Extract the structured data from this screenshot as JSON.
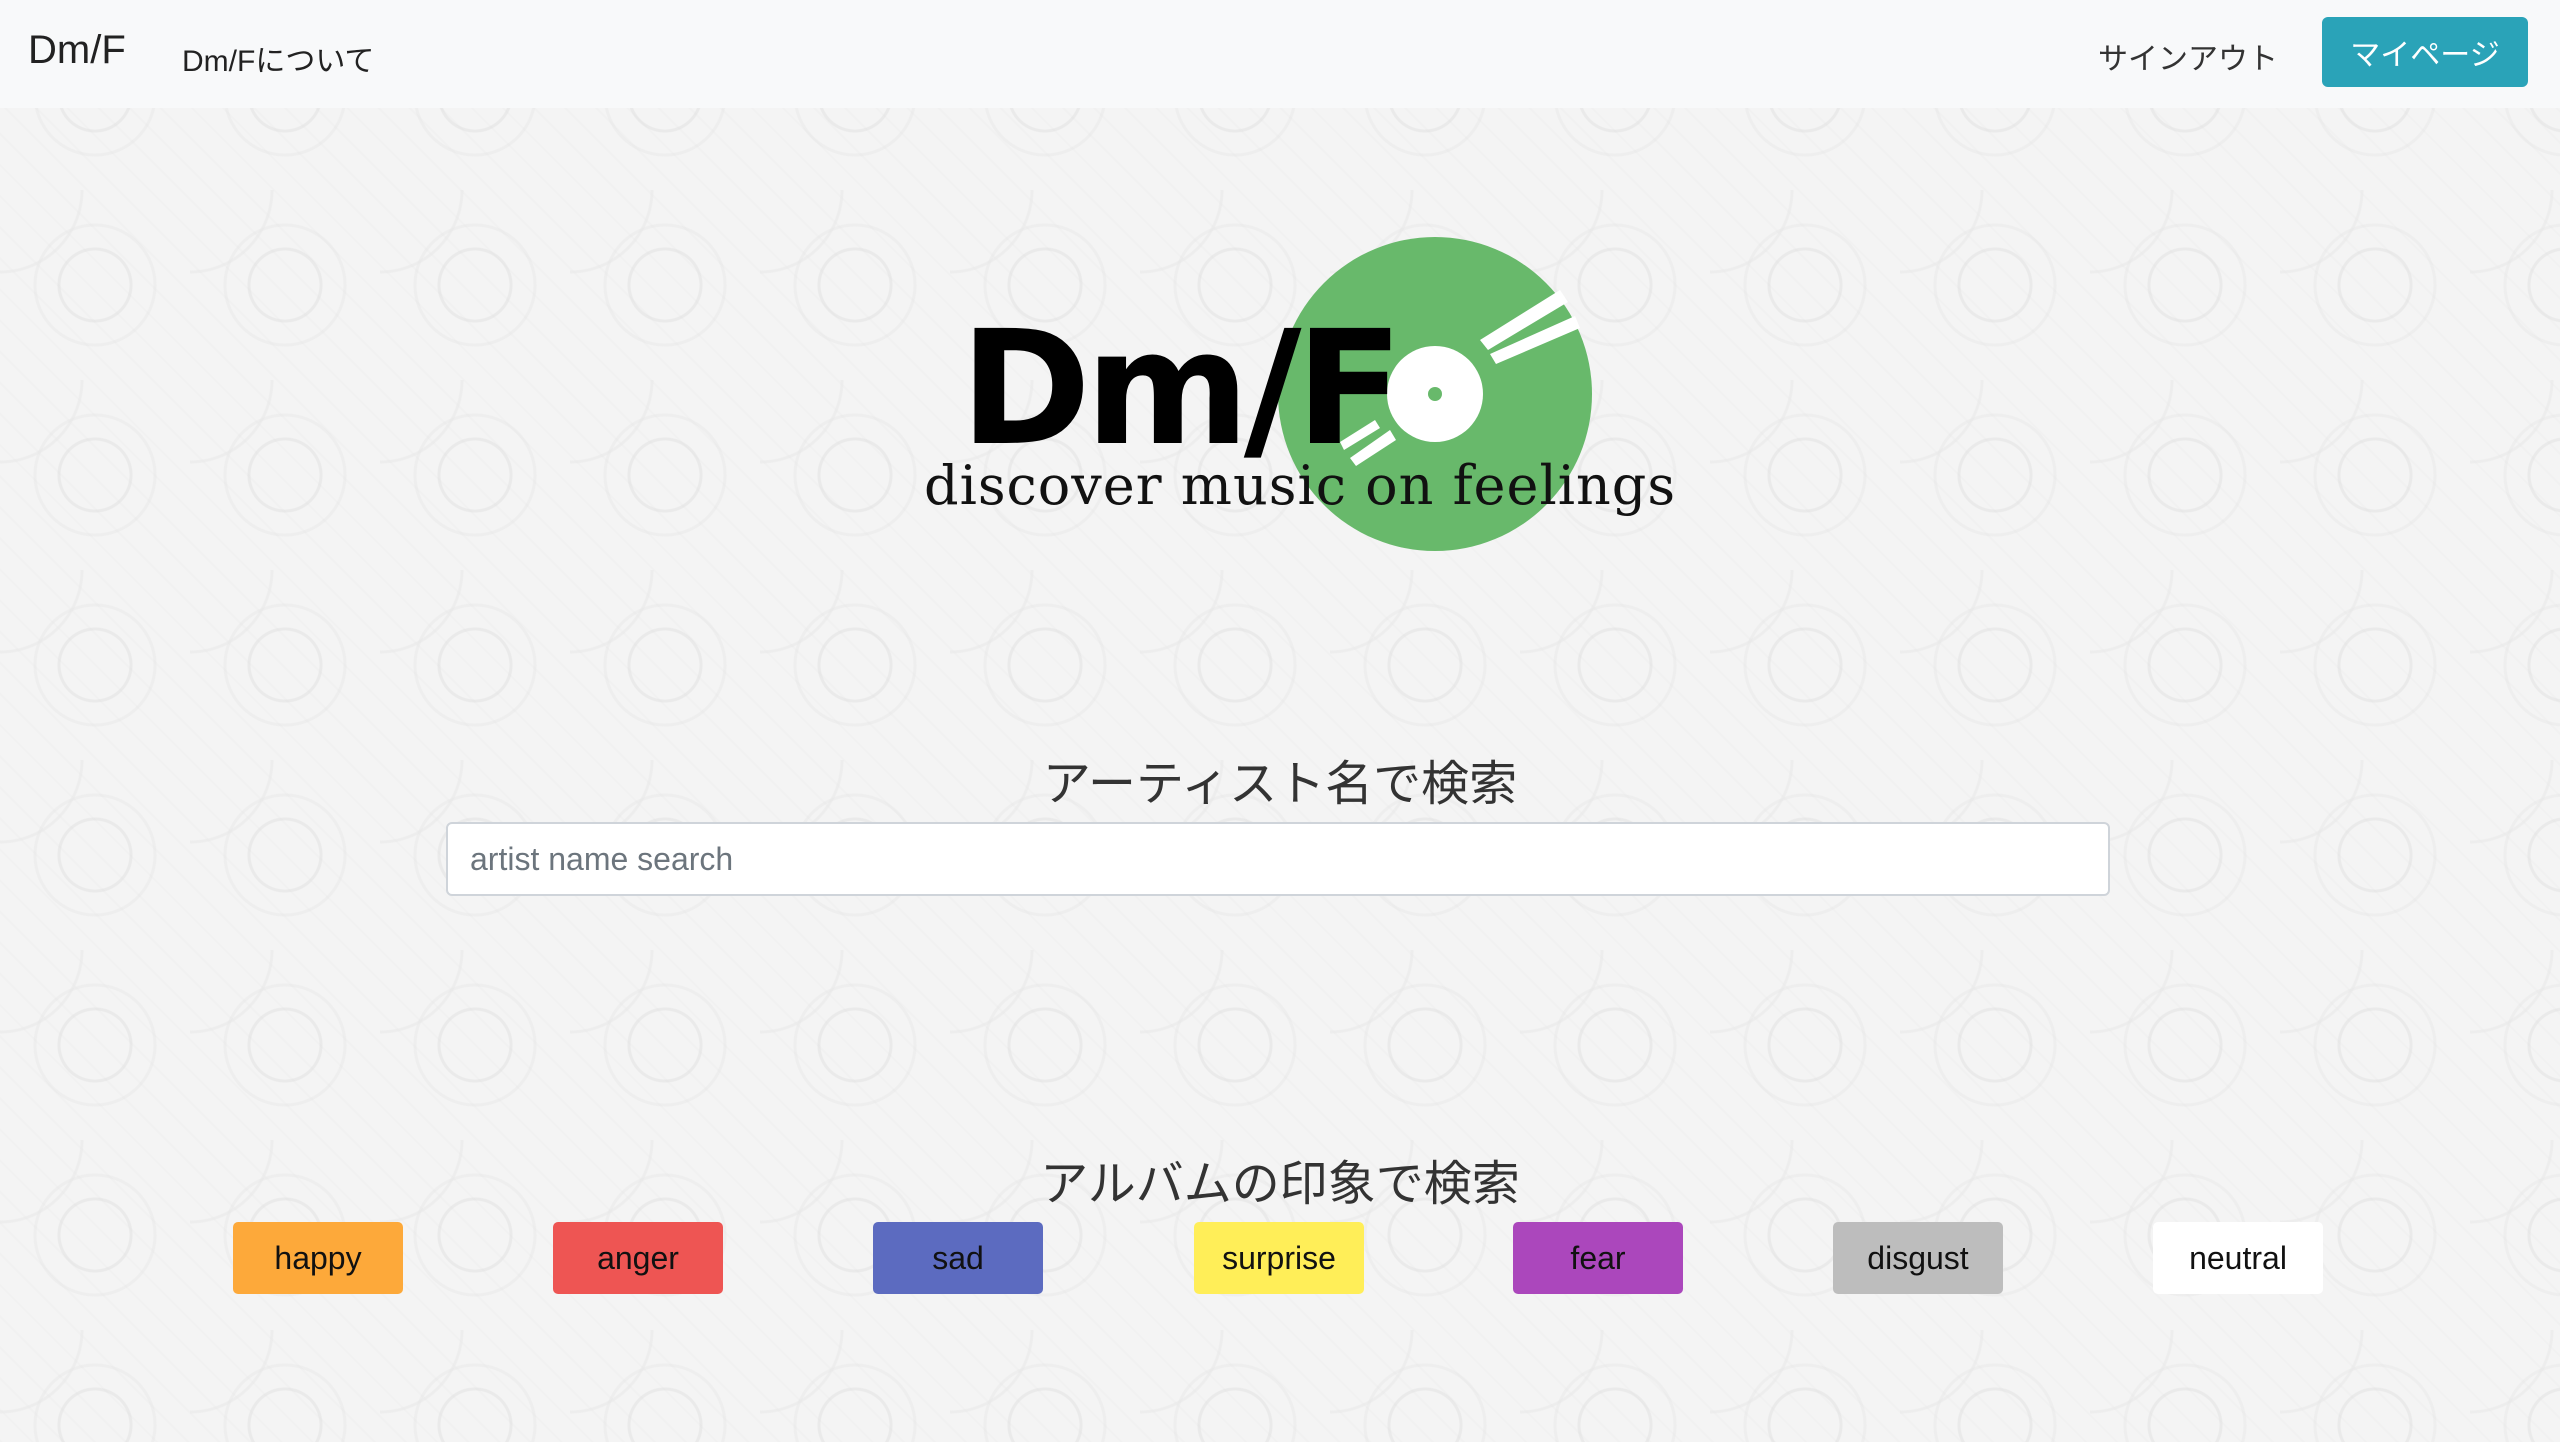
{
  "navbar": {
    "brand": "Dm/F",
    "about": "Dm/Fについて",
    "signout": "サインアウト",
    "mypage": "マイページ"
  },
  "logo": {
    "text": "Dm/F",
    "tagline": "discover music on feelings",
    "disc_color": "#68b96b"
  },
  "artist_search": {
    "heading": "アーティスト名で検索",
    "placeholder": "artist name search"
  },
  "album_search": {
    "heading": "アルバムの印象で検索",
    "emotions": [
      {
        "label": "happy",
        "color": "#fda93a"
      },
      {
        "label": "anger",
        "color": "#ee5553"
      },
      {
        "label": "sad",
        "color": "#5c6bc0"
      },
      {
        "label": "surprise",
        "color": "#ffee58"
      },
      {
        "label": "fear",
        "color": "#ab47bc"
      },
      {
        "label": "disgust",
        "color": "#bdbdbd"
      },
      {
        "label": "neutral",
        "color": "#ffffff"
      }
    ]
  },
  "colors": {
    "accent": "#2aa3b8",
    "navbar_bg": "#f8f9fa"
  }
}
